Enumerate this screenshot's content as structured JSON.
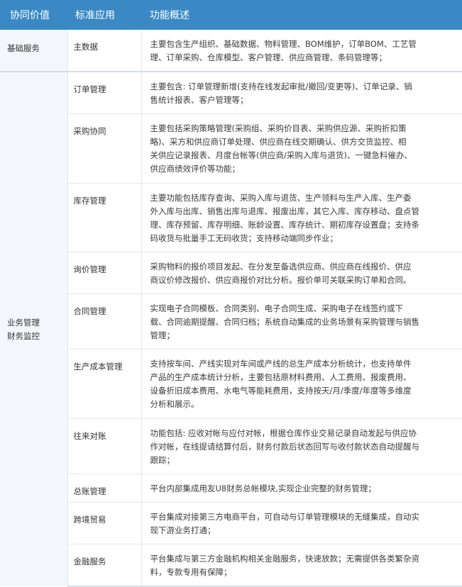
{
  "header": {
    "col1": "协同价值",
    "col2": "标准应用",
    "col3": "功能概述"
  },
  "groups": [
    {
      "value_lines": [
        "基础服务"
      ],
      "rows": [
        {
          "app": "主数据",
          "desc": [
            "主要包含生产组织、基础数据、物料管理、BOM维护，订单BOM、工艺管",
            "理、订单采购、仓库模型、客户管理、供应商管理、条码管理等；"
          ]
        }
      ]
    },
    {
      "value_lines": [
        "业务管理",
        "财务监控"
      ],
      "rows": [
        {
          "app": "订单管理",
          "desc": [
            "主要包含: 订单管理新增(支持在线发起审批/撤回/变更等)、订单记录、销",
            "售统计报表、客户管理等；"
          ]
        },
        {
          "app": "采购协同",
          "desc": [
            "主要包括采购策略管理(采购组、采购价目表、采购供应源、采购折扣策",
            "略)、采方和供应商订单处理、供应商在线交期确认、供方交货监控、相",
            "关供应记录报表、月度台帐等(供应商/采购入库与退货)、一键急料催办、",
            "供应商绩效评价等功能；"
          ]
        },
        {
          "app": "库存管理",
          "desc": [
            "主要功能包括库存查询、采购入库与退货、生产领料与生产入库、生产委",
            "外入库与出库、销售出库与退库、报废出库，其它入库、库存移动、盘点管",
            "理、库存预留、库存明细、账龄设置、库存统计、期初库存设置盘；支持条",
            "码收货与批量手工无码收货；支持移动端同步作业；"
          ]
        },
        {
          "app": "询价管理",
          "desc": [
            "采购物料的报价项目发起、在分发至备选供应商、供应商在线报价、供应",
            "商议价修改报价、供应商报价对比分析。报价单可关联采购订单和合同。"
          ]
        },
        {
          "app": "合同管理",
          "desc": [
            "实现电子合同模板、合同类别、电子合同生成、采购电子在线签约或下",
            "载、合同逾期提醒、合同归档；系统自动集成的业务场景有采购管理与销售",
            "管理；"
          ]
        },
        {
          "app": "生产成本管理",
          "desc": [
            "支持按车间、产线实现对车间或产线的总生产成本分析统计，也支持单件",
            "产品的生产成本统计分析，主要包括原材料费用、人工费用、报废费用、",
            "设备折旧成本费用、水电气等能耗费用，支持按天/月/季度/年度等多维度",
            "分析和展示。"
          ]
        },
        {
          "app": "往来对账",
          "desc": [
            "功能包括: 应收对帐与应付对帐，根据仓库作业交易记录自动发起与供应协",
            "作对帐，在线提请结算付后，财务付款后状态回写与收付款状态自动提醒与",
            "跟踪；"
          ]
        },
        {
          "app": "总账管理",
          "desc": [
            "平台内部集成用友U8财务总帐模块,实现企业完整的财务管理；"
          ]
        },
        {
          "app": "跨境贸易",
          "desc": [
            "平台集成对接第三方电商平台，可自动与订单管理模块的无缝集成，自动实",
            "现下游业务打通；"
          ]
        },
        {
          "app": "金融服务",
          "desc": [
            "平台集成与第三方金融机构相关金融服务，快速放款；无需提供各类繁杂资",
            "料，专款专用有保障；"
          ]
        }
      ]
    }
  ]
}
